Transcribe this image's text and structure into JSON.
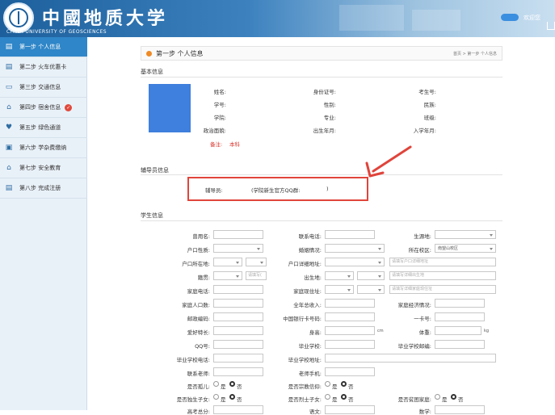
{
  "header": {
    "title_cn": "中國地质大学",
    "title_en": "CHINA UNIVERSITY OF GEOSCIENCES",
    "welcome": "欢迎您"
  },
  "sidebar": {
    "items": [
      {
        "label": "第一步 个人信息",
        "icon": "document-icon",
        "active": true
      },
      {
        "label": "第二步 火车优惠卡",
        "icon": "document-icon"
      },
      {
        "label": "第三步 交通信息",
        "icon": "monitor-icon"
      },
      {
        "label": "第四步 宿舍信息",
        "icon": "home-icon",
        "badge": "✓"
      },
      {
        "label": "第五步 绿色通道",
        "icon": "heart-icon"
      },
      {
        "label": "第六步 学杂费缴纳",
        "icon": "receipt-icon"
      },
      {
        "label": "第七步 安全教育",
        "icon": "home-icon"
      },
      {
        "label": "第八步 完成注册",
        "icon": "document-icon"
      }
    ]
  },
  "page": {
    "step_title": "第一步 个人信息",
    "breadcrumb": "首页 > 第一步 个人信息"
  },
  "basic": {
    "title": "基本信息",
    "name": "姓名:",
    "id_no": "身份证号:",
    "exam_no": "考生号:",
    "student_no": "学号:",
    "gender": "性别:",
    "ethnicity": "民族:",
    "college": "学院:",
    "major": "专业:",
    "class": "班级:",
    "political": "政治面貌:",
    "birth": "出生年月:",
    "enroll": "入学年月:",
    "note_label": "备注:",
    "note_value": "本科"
  },
  "counselor": {
    "title": "辅导员信息",
    "label": "辅导员:",
    "qq": "(学院新生官方QQ群:",
    "qq_end": ")"
  },
  "student": {
    "title": "学生信息",
    "used_name": "曾用名:",
    "phone": "联系电话:",
    "origin": "生源地:",
    "hukou_type": "户口性质:",
    "marital": "婚姻情况:",
    "campus": "所在校区:",
    "campus_value": "南望山校区",
    "hukou_place": "户口所在地:",
    "hukou_detail": "户口详细地址:",
    "hukou_detail_ph": "请填写户口详细地址",
    "native": "籍贯:",
    "native_ph": "请填写(",
    "birthplace": "出生地:",
    "birthplace_ph": "请填写详细出生地",
    "home_phone": "家庭电话:",
    "home_addr": "家庭现住址:",
    "home_addr_ph": "请填写详细家庭现住址",
    "home_pop": "家庭人口数:",
    "annual_income": "全年总收入:",
    "economy": "家庭经济情况:",
    "postcode": "邮政编码:",
    "bank_card": "中国银行卡号码:",
    "card": "一卡号:",
    "hobby": "爱好特长:",
    "height": "身高:",
    "height_unit": "cm",
    "weight": "体重:",
    "weight_unit": "kg",
    "qq": "QQ号:",
    "grad_school": "毕业学校:",
    "school_code": "毕业学校邮编:",
    "school_phone": "毕业学校电话:",
    "school_addr": "毕业学校地址:",
    "teacher": "联系老师:",
    "teacher_phone": "老师手机:",
    "orphan": "是否孤儿:",
    "religion": "是否宗教信仰:",
    "only_child": "是否独生子女:",
    "martyr": "是否烈士子女:",
    "poor_family": "是否贫困家庭:",
    "yes": "是",
    "no": "否",
    "total_score": "高考总分:",
    "chinese": "语文:",
    "math": "数学:"
  }
}
